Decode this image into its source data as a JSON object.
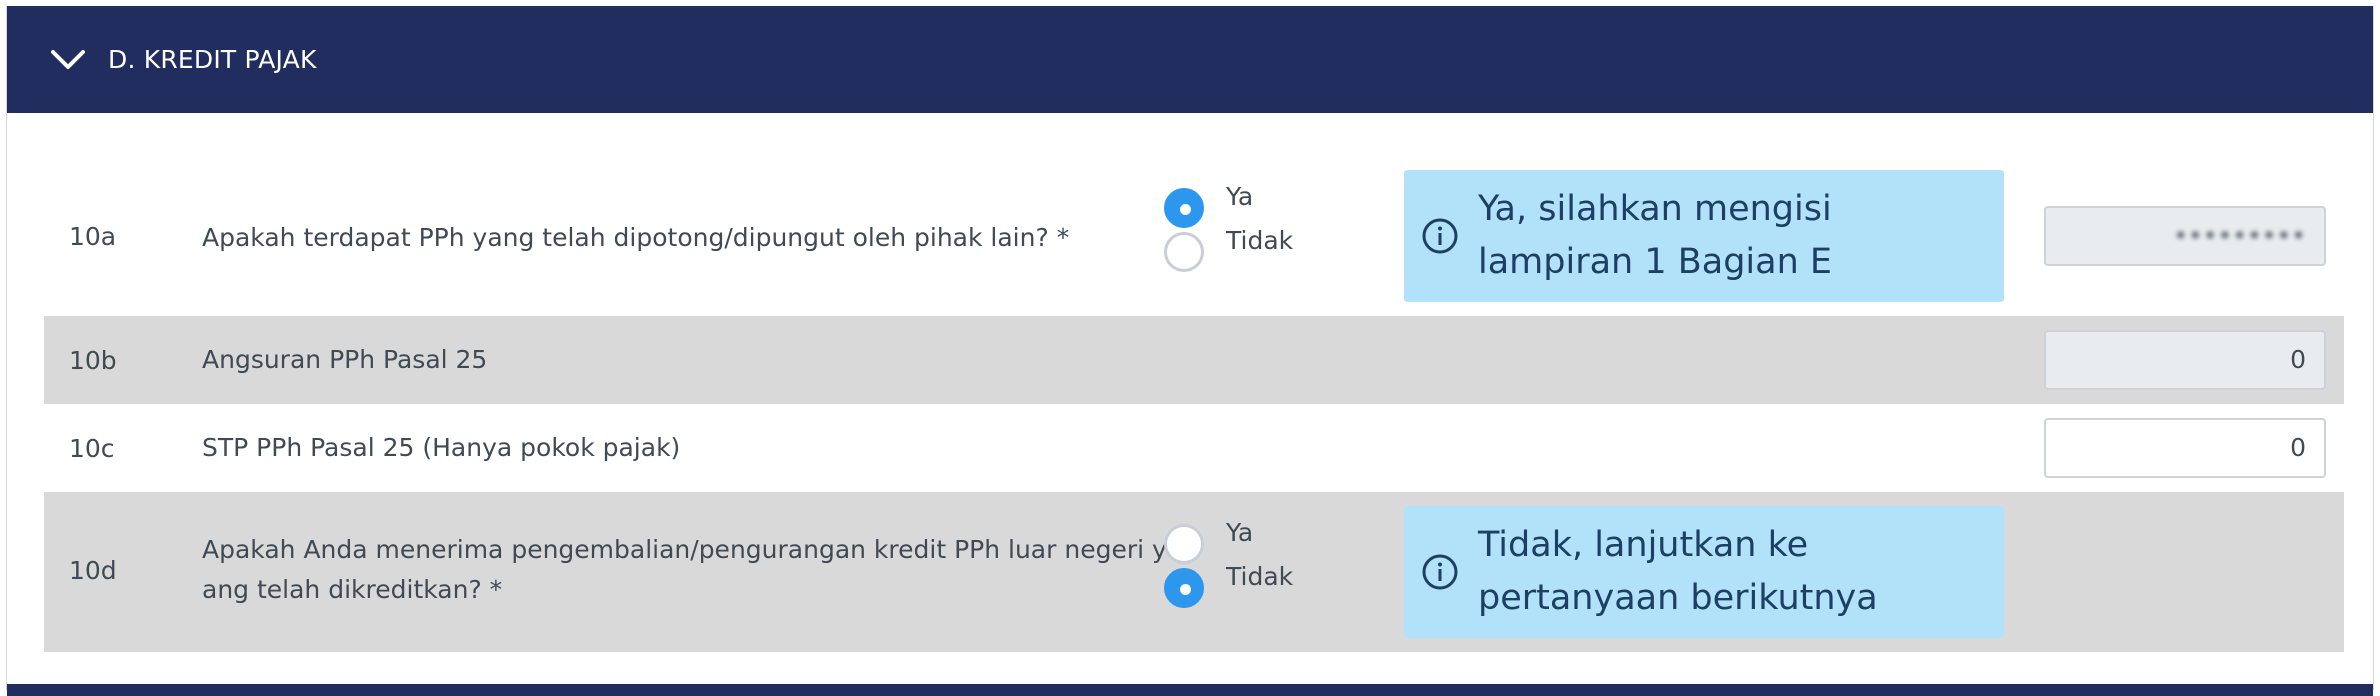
{
  "section": {
    "title": "D. KREDIT PAJAK",
    "toggle_icon": "chevron-down-icon"
  },
  "rows": [
    {
      "number": "10a",
      "label": "Apakah terdapat PPh yang telah dipotong/dipungut oleh pihak lain? *",
      "radio": {
        "yes": "Ya",
        "no": "Tidak",
        "selected": "Ya"
      },
      "info": "Ya, silahkan mengisi lampiran 1 Bagian E",
      "value": "•••••••••"
    },
    {
      "number": "10b",
      "label": "Angsuran PPh Pasal 25",
      "value": "0"
    },
    {
      "number": "10c",
      "label": "STP PPh Pasal 25 (Hanya pokok pajak)",
      "value": "0"
    },
    {
      "number": "10d",
      "label_line1": "Apakah Anda menerima pengembalian/pengurangan kredit PPh luar negeri y",
      "label_line2": "ang telah dikreditkan? *",
      "radio": {
        "yes": "Ya",
        "no": "Tidak",
        "selected": "Tidak"
      },
      "info": "Tidak, lanjutkan ke pertanyaan berikutnya"
    }
  ],
  "colors": {
    "header_bg": "#212c5f",
    "radio_selected": "#2d97ee",
    "info_bg": "#b1e2fa",
    "row_alt_bg": "#d9d9d9"
  }
}
